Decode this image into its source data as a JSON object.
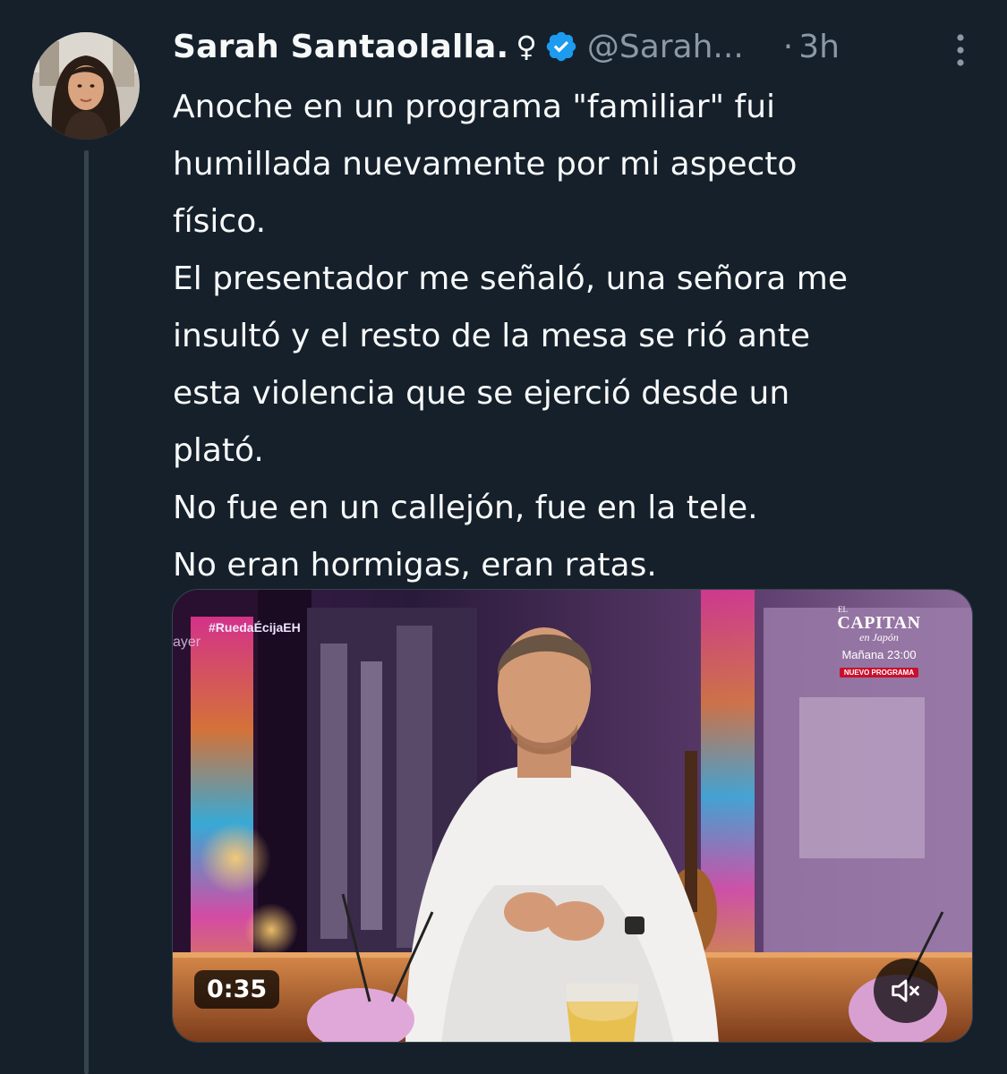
{
  "author": {
    "display_name": "Sarah Santaolalla.",
    "name_emoji": "♀",
    "handle": "@Sarah...",
    "verified": true
  },
  "meta": {
    "separator": "·",
    "time": "3h"
  },
  "tweet": {
    "lines": [
      "Anoche en un programa \"familiar\" fui",
      "humillada nuevamente por mi aspecto",
      "físico.",
      "El presentador me señaló, una señora me",
      "insultó y el resto de la mesa se rió ante",
      "esta violencia que se ejerció desde un",
      "plató.",
      "No fue en un callejón, fue en la tele.",
      "No eran hormigas, eran ratas."
    ]
  },
  "video": {
    "duration": "0:35",
    "overlay": {
      "hashtag": "#RuedaÉcijaEH",
      "channel_logo": "ayer",
      "promo_prefix": "EL",
      "promo_title": "CAPITAN",
      "promo_subtitle": "en Japón",
      "promo_time": "Mañana 23:00",
      "promo_badge": "NUEVO PROGRAMA"
    }
  },
  "colors": {
    "background": "#15202b",
    "text_primary": "#f7f9f9",
    "text_secondary": "#8b98a5",
    "verified_blue": "#1d9bf0",
    "thread_line": "#38444d"
  },
  "icons": {
    "verified": "verified-badge-icon",
    "more": "more-dots-icon",
    "mute": "speaker-muted-icon"
  }
}
